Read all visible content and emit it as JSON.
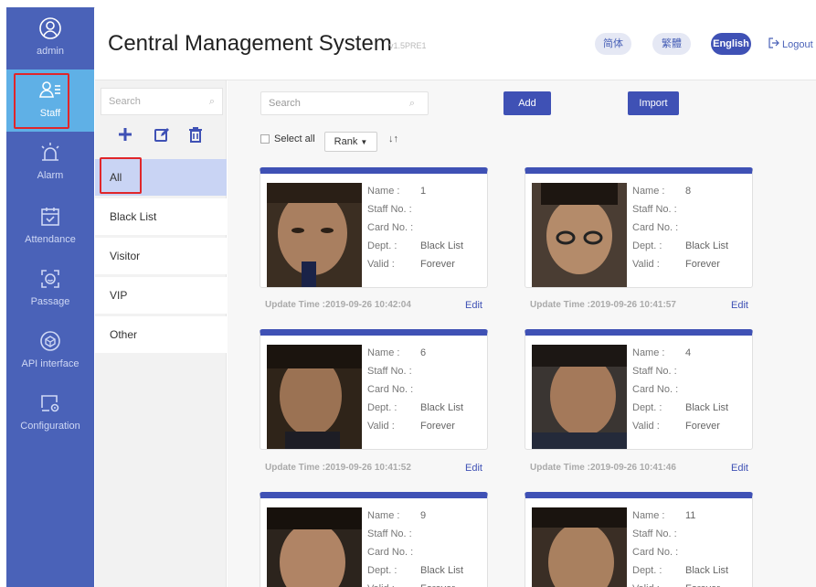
{
  "nav": {
    "items": [
      {
        "label": "admin",
        "icon": "user-circle-icon"
      },
      {
        "label": "Staff",
        "icon": "staff-icon"
      },
      {
        "label": "Alarm",
        "icon": "alarm-icon"
      },
      {
        "label": "Attendance",
        "icon": "calendar-check-icon"
      },
      {
        "label": "Passage",
        "icon": "face-scan-icon"
      },
      {
        "label": "API interface",
        "icon": "cube-icon"
      },
      {
        "label": "Configuration",
        "icon": "settings-icon"
      }
    ]
  },
  "header": {
    "title": "Central Management System",
    "version": "v1.5PRE1",
    "langs": [
      "简体",
      "繁體",
      "English"
    ],
    "logout": "Logout"
  },
  "categories": {
    "search_placeholder": "Search",
    "items": [
      "All",
      "Black List",
      "Visitor",
      "VIP",
      "Other"
    ]
  },
  "toolbar": {
    "search_placeholder": "Search",
    "add_label": "Add",
    "import_label": "Import",
    "select_all_label": "Select all",
    "rank_label": "Rank"
  },
  "labels": {
    "name": "Name :",
    "staff_no": "Staff No. :",
    "card_no": "Card No. :",
    "dept": "Dept. :",
    "valid": "Valid :",
    "update_prefix": "Update Time :",
    "edit": "Edit"
  },
  "cards": [
    {
      "name": "1",
      "dept": "Black List",
      "valid": "Forever",
      "update": "2019-09-26 10:42:04"
    },
    {
      "name": "8",
      "dept": "Black List",
      "valid": "Forever",
      "update": "2019-09-26 10:41:57"
    },
    {
      "name": "6",
      "dept": "Black List",
      "valid": "Forever",
      "update": "2019-09-26 10:41:52"
    },
    {
      "name": "4",
      "dept": "Black List",
      "valid": "Forever",
      "update": "2019-09-26 10:41:46"
    },
    {
      "name": "9",
      "dept": "Black List",
      "valid": "Forever",
      "update": ""
    },
    {
      "name": "11",
      "dept": "Black List",
      "valid": "Forever",
      "update": ""
    }
  ],
  "colors": {
    "nav_bg": "#4a62b8",
    "nav_active": "#5fb0e6",
    "accent": "#3f51b5",
    "highlight_box": "#e0262a"
  }
}
